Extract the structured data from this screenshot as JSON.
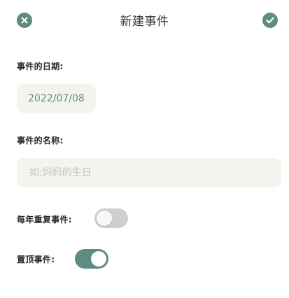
{
  "header": {
    "title": "新建事件",
    "close_icon": "close-circle-icon",
    "confirm_icon": "check-circle-icon"
  },
  "date_section": {
    "label": "事件的日期:",
    "value": "2022/07/08"
  },
  "name_section": {
    "label": "事件的名称:",
    "placeholder": "如:妈妈的生日",
    "value": ""
  },
  "repeat_section": {
    "label": "每年重复事件:",
    "enabled": false
  },
  "pin_section": {
    "label": "置顶事件:",
    "enabled": true
  },
  "colors": {
    "accent": "#5f8c80",
    "field_background": "#f4f4ef",
    "toggle_off": "#cfcfcf"
  }
}
